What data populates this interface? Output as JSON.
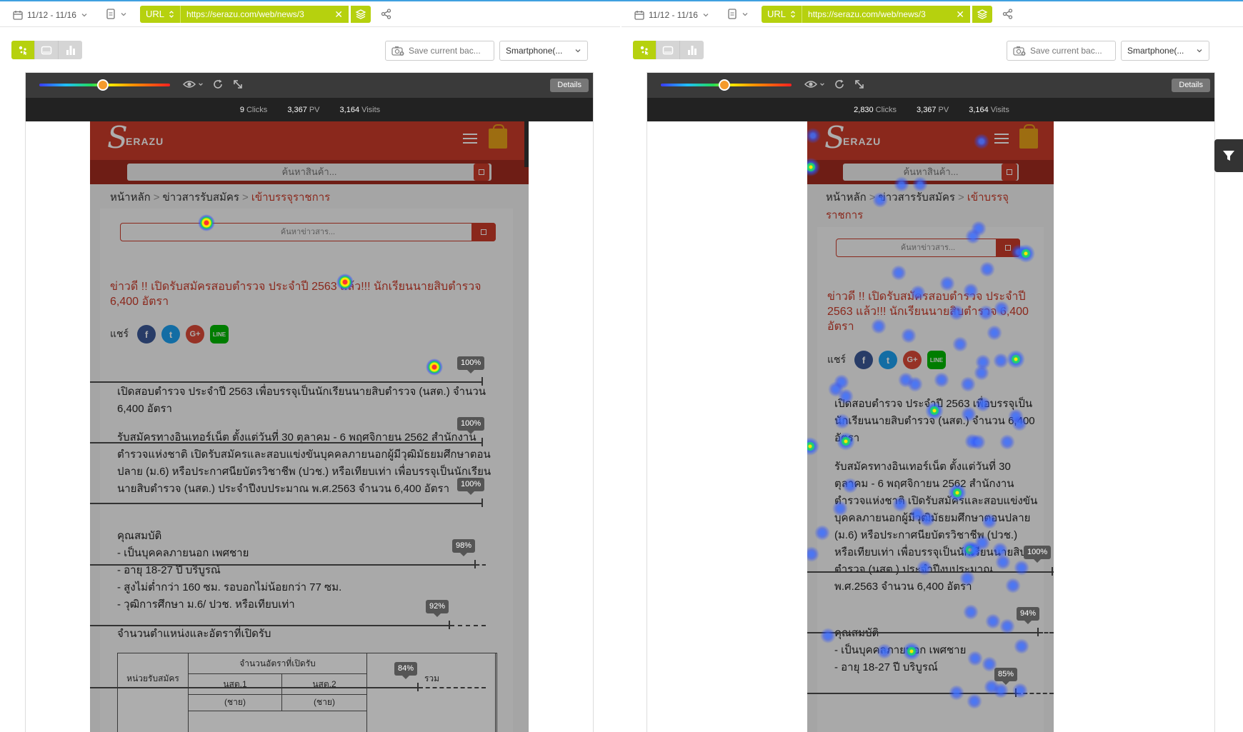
{
  "colors": {
    "accent": "#b6d10e",
    "site_red": "#cc3b2a",
    "toolbar_dark": "#3a3a3a"
  },
  "icons": [
    "calendar-icon",
    "document-icon",
    "chevron-down-icon",
    "layers-icon",
    "share-icon",
    "click-heatmap-icon",
    "device-icon",
    "chart-icon",
    "camera-icon",
    "eye-icon",
    "refresh-icon",
    "expand-icon",
    "filter-icon",
    "facebook-icon",
    "twitter-icon",
    "googleplus-icon",
    "line-icon",
    "menu-icon",
    "cart-icon"
  ],
  "panes": [
    {
      "date_range": "11/12 - 11/16",
      "url_mode": "URL",
      "url": "https://serazu.com/web/news/3",
      "save_label": "Save current bac...",
      "device": "Smartphone(...",
      "details_label": "Details",
      "stats": {
        "clicks": "9",
        "clicks_label": "Clicks",
        "pv": "3,367",
        "pv_label": "PV",
        "visits": "3,164",
        "visits_label": "Visits"
      },
      "site": {
        "logo": "ERAZU",
        "logo_s": "S",
        "search_placeholder": "ค้นหาสินค้า...",
        "bc_home": "หน้าหลัก",
        "bc_sep": ">",
        "bc_mid": "ข่าวสารรับสมัคร",
        "bc_cur": "เข้าบรรจุราชการ",
        "news_search": "ค้นหาข่าวสาร...",
        "headline": "ข่าวดี !! เปิดรับสมัครสอบตำรวจ ประจำปี 2563 แล้ว!!! นักเรียนนายสิบตำรวจ 6,400 อัตรา",
        "share_label": "แชร์",
        "p1": "เปิดสอบตำรวจ ประจำปี 2563 เพื่อบรรจุเป็นนักเรียนนายสิบตำรวจ (นสต.) จำนวน 6,400 อัตรา",
        "p2": "รับสมัครทางอินเทอร์เน็ต ตั้งแต่วันที่ 30 ตุลาคม - 6 พฤศจิกายน 2562 สำนักงานตำรวจแห่งชาติ เปิดรับสมัครและสอบแข่งขันบุคคลภายนอกผู้มีวุฒิมัธยมศึกษาตอนปลาย (ม.6) หรือประกาศนียบัตรวิชาชีพ (ปวช.) หรือเทียบเท่า เพื่อบรรจุเป็นนักเรียนนายสิบตำรวจ (นสต.) ประจำปีงบประมาณ พ.ศ.2563 จำนวน 6,400 อัตรา",
        "q_title": "คุณสมบัติ",
        "q1": "- เป็นบุคคลภายนอก เพศชาย",
        "q2": "- อายุ 18-27 ปี บริบูรณ์",
        "q3": "- สูงไม่ต่ำกว่า 160 ซม. รอบอกไม่น้อยกว่า 77 ซม.",
        "q4": "- วุฒิการศึกษา ม.6/ ปวช. หรือเทียบเท่า",
        "pos_title": "จำนวนตำแหน่งและอัตราที่เปิดรับ",
        "t_unit": "หน่วยรับสมัคร",
        "t_count": "จำนวนอัตราที่เปิดรับ",
        "t_n1": "นสต.1",
        "t_n2": "นสต.2",
        "t_sum": "รวม",
        "t_sub": "(ชาย)"
      },
      "scroll_markers": [
        "100%",
        "100%",
        "100%",
        "98%",
        "92%",
        "84%"
      ],
      "scroll_reach": [
        1.0,
        1.0,
        1.0,
        0.98,
        0.92,
        0.84
      ]
    },
    {
      "date_range": "11/12 - 11/16",
      "url_mode": "URL",
      "url": "https://serazu.com/web/news/3",
      "save_label": "Save current bac...",
      "device": "Smartphone(...",
      "details_label": "Details",
      "stats": {
        "clicks": "2,830",
        "clicks_label": "Clicks",
        "pv": "3,367",
        "pv_label": "PV",
        "visits": "3,164",
        "visits_label": "Visits"
      },
      "site": {
        "logo": "ERAZU",
        "logo_s": "S",
        "search_placeholder": "ค้นหาสินค้า...",
        "bc_home": "หน้าหลัก",
        "bc_sep": ">",
        "bc_mid": "ข่าวสารรับสมัคร",
        "bc_cur": "เข้าบรรจุราชการ",
        "news_search": "ค้นหาข่าวสาร...",
        "headline": "ข่าวดี !! เปิดรับสมัครสอบตำรวจ ประจำปี 2563 แล้ว!!! นักเรียนนายสิบตำรวจ 6,400 อัตรา",
        "share_label": "แชร์",
        "p1": "เปิดสอบตำรวจ ประจำปี 2563 เพื่อบรรจุเป็นนักเรียนนายสิบตำรวจ (นสต.) จำนวน 6,400 อัตรา",
        "p2": "รับสมัครทางอินเทอร์เน็ต ตั้งแต่วันที่ 30 ตุลาคม - 6 พฤศจิกายน 2562 สำนักงานตำรวจแห่งชาติ เปิดรับสมัครและสอบแข่งขันบุคคลภายนอกผู้มีวุฒิมัธยมศึกษาตอนปลาย (ม.6) หรือประกาศนียบัตรวิชาชีพ (ปวช.) หรือเทียบเท่า เพื่อบรรจุเป็นนักเรียนนายสิบตำรวจ (นสต.) ประจำปีงบประมาณ พ.ศ.2563 จำนวน 6,400 อัตรา",
        "q_title": "คุณสมบัติ",
        "q1": "- เป็นบุคคลภายนอก เพศชาย",
        "q2": "- อายุ 18-27 ปี บริบูรณ์"
      },
      "scroll_markers": [
        "100%",
        "94%",
        "85%"
      ],
      "scroll_reach": [
        1.0,
        0.94,
        0.85
      ]
    }
  ]
}
